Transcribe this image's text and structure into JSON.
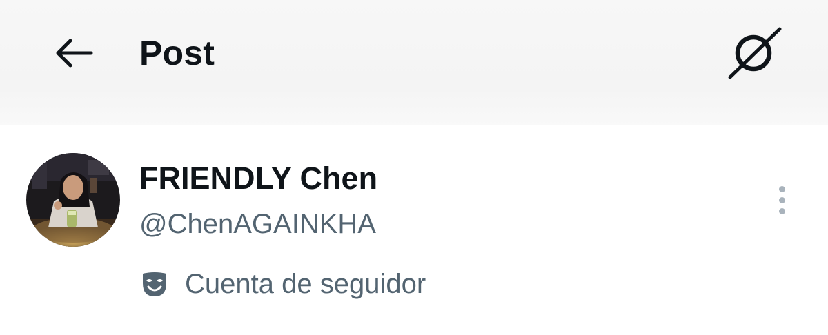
{
  "header": {
    "back_icon": "arrow-left-icon",
    "title": "Post",
    "grok_icon": "grok-icon"
  },
  "post": {
    "author": {
      "avatar_icon": "profile-photo",
      "display_name": "FRIENDLY Chen",
      "handle": "@ChenAGAINKHA",
      "account_type": {
        "icon": "mask-icon",
        "label": "Cuenta de seguidor"
      }
    },
    "more_icon": "more-vertical-icon"
  },
  "colors": {
    "text_primary": "#0f1419",
    "text_secondary": "#536471",
    "header_bg": "#f5f5f5",
    "icon_muted": "#a9b3bc"
  }
}
